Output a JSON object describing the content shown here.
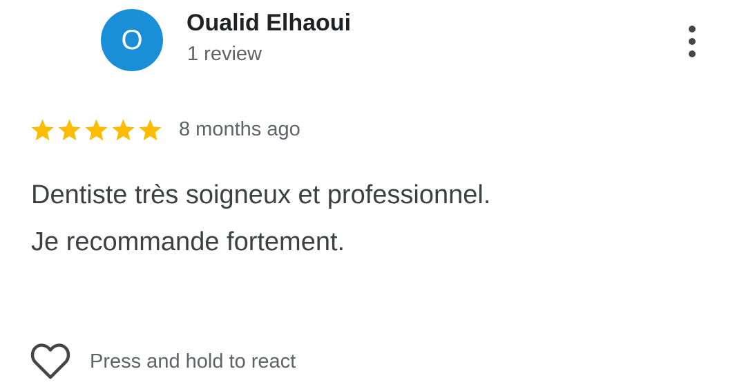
{
  "reviewer": {
    "initial": "O",
    "name": "Oualid Elhaoui",
    "review_count": "1 review",
    "avatar_color": "#1a8fd8"
  },
  "menu": {
    "icon": "more-vert-icon"
  },
  "review": {
    "rating": 5,
    "max_rating": 5,
    "star_color": "#fbbc04",
    "time": "8 months ago",
    "text_lines": [
      "Dentiste très soigneux et professionnel.",
      "Je recommande fortement."
    ]
  },
  "reactions": {
    "icon": "heart-outline-icon",
    "label": "Press and hold to react"
  }
}
